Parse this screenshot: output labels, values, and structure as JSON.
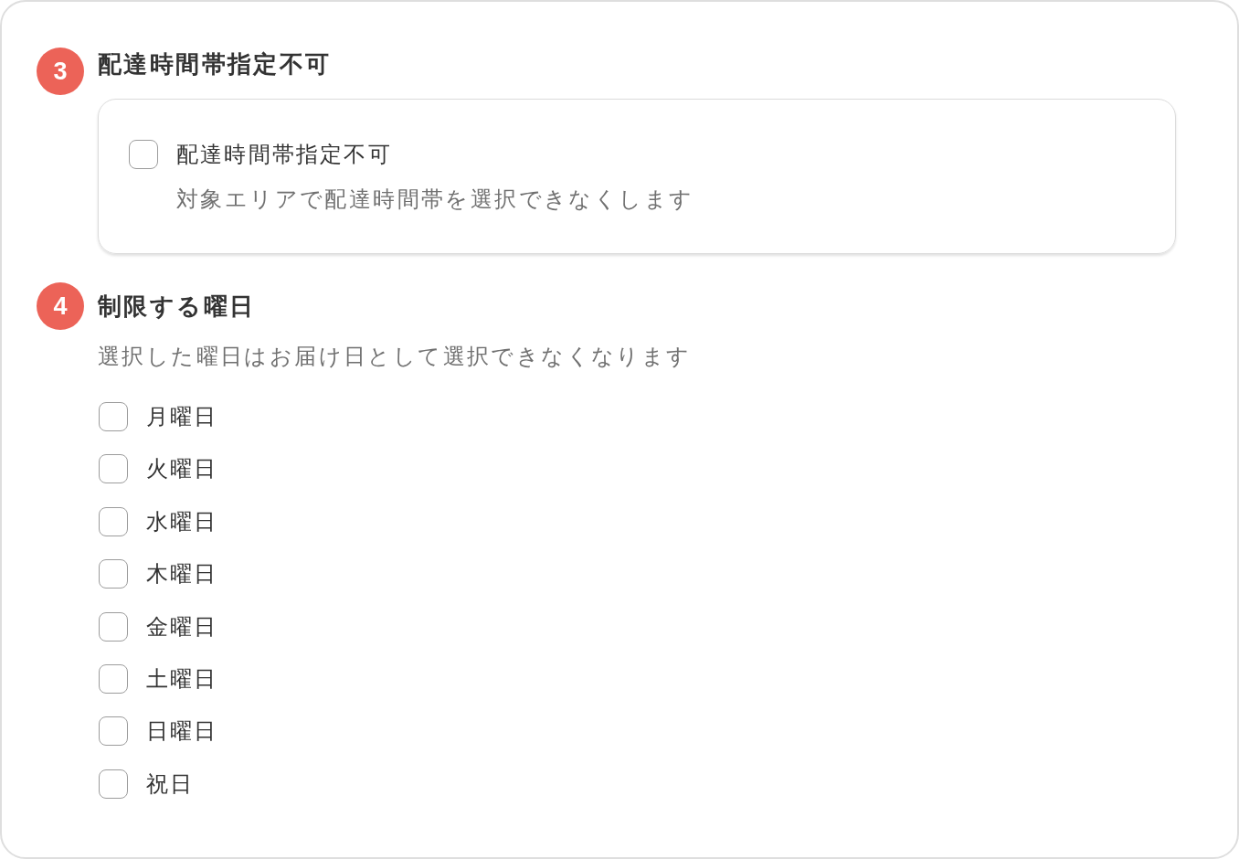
{
  "sections": [
    {
      "kind": "boxed",
      "number": "3",
      "title": "配達時間帯指定不可",
      "options": [
        {
          "label": "配達時間帯指定不可",
          "description": "対象エリアで配達時間帯を選択できなくします",
          "checked": false
        }
      ]
    },
    {
      "kind": "list",
      "number": "4",
      "title": "制限する曜日",
      "description": "選択した曜日はお届け日として選択できなくなります",
      "options": [
        {
          "label": "月曜日",
          "checked": false
        },
        {
          "label": "火曜日",
          "checked": false
        },
        {
          "label": "水曜日",
          "checked": false
        },
        {
          "label": "木曜日",
          "checked": false
        },
        {
          "label": "金曜日",
          "checked": false
        },
        {
          "label": "土曜日",
          "checked": false
        },
        {
          "label": "日曜日",
          "checked": false
        },
        {
          "label": "祝日",
          "checked": false
        }
      ]
    }
  ]
}
